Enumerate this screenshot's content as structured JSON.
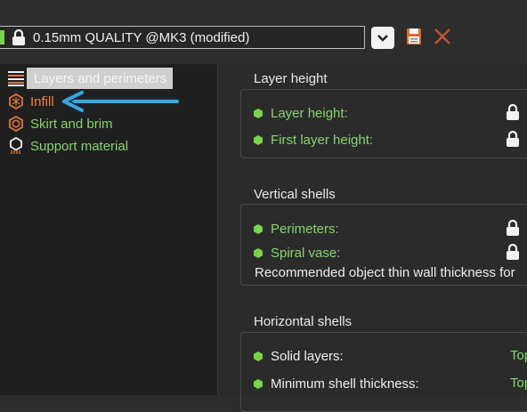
{
  "preset": {
    "name": "0.15mm QUALITY @MK3 (modified)"
  },
  "tree": [
    {
      "label": "Layers and perimeters",
      "icon": "layers-icon",
      "selected": true
    },
    {
      "label": "Infill",
      "icon": "infill-icon",
      "selected": false
    },
    {
      "label": "Skirt and brim",
      "icon": "skirt-icon",
      "selected": false
    },
    {
      "label": "Support material",
      "icon": "support-icon",
      "selected": false
    }
  ],
  "sections": {
    "layer_height": {
      "title": "Layer height",
      "options": [
        "Layer height:",
        "First layer height:"
      ]
    },
    "vertical_shells": {
      "title": "Vertical shells",
      "options": [
        "Perimeters:",
        "Spiral vase:"
      ],
      "note": "Recommended object thin wall thickness for"
    },
    "horizontal_shells": {
      "title": "Horizontal shells",
      "options": [
        "Solid layers:",
        "Minimum shell thickness:"
      ],
      "trailing": [
        "Top",
        "Top"
      ]
    }
  },
  "colors": {
    "green": "#86d56d",
    "orange": "#f08040",
    "annotation_arrow": "#3aa6dd"
  }
}
